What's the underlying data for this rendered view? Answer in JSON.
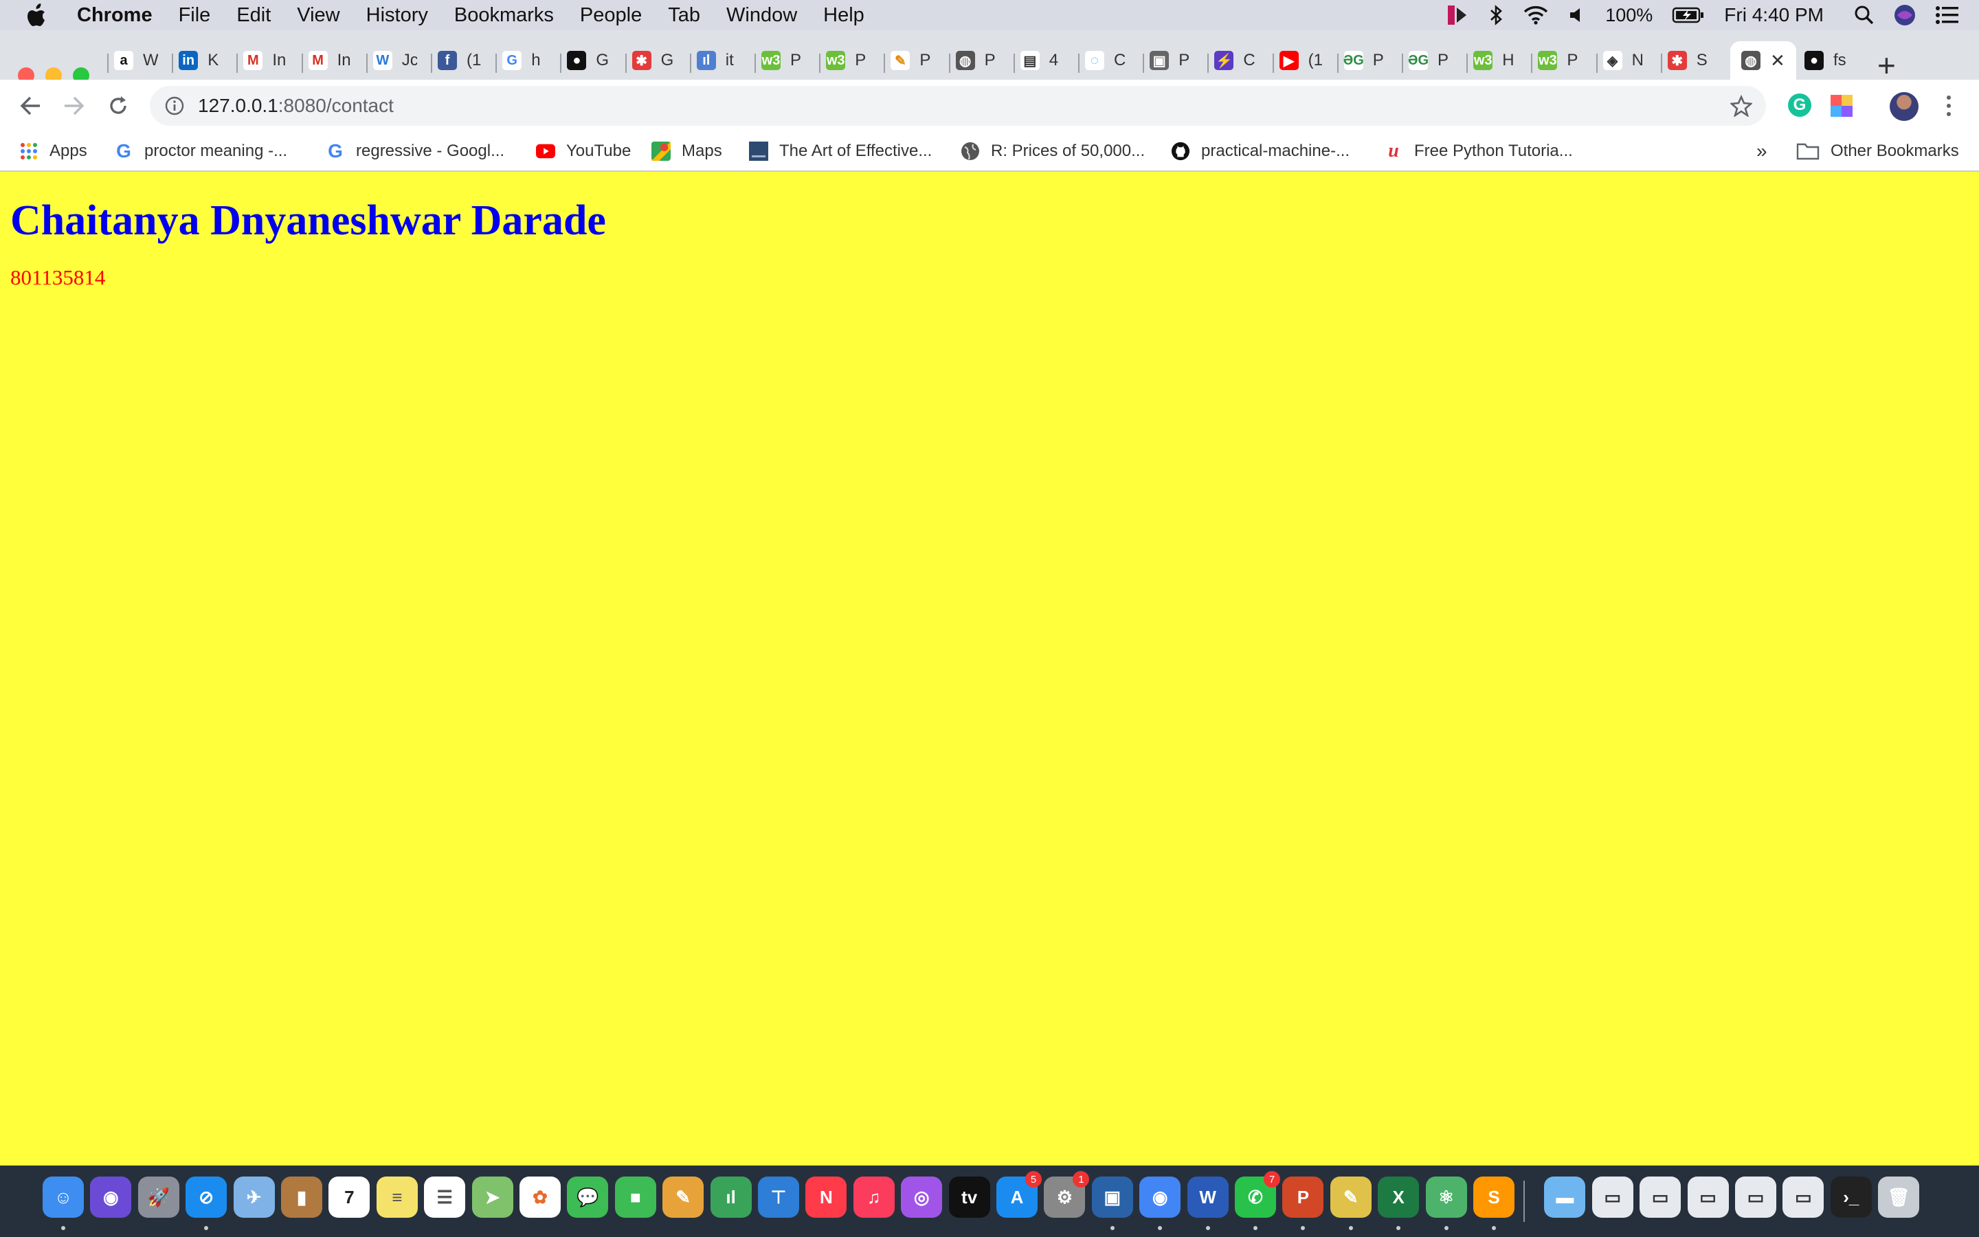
{
  "menubar": {
    "app_name": "Chrome",
    "items": [
      "File",
      "Edit",
      "View",
      "History",
      "Bookmarks",
      "People",
      "Tab",
      "Window",
      "Help"
    ],
    "battery": "100%",
    "clock": "Fri 4:40 PM"
  },
  "tabs": [
    {
      "label": "W",
      "icon": "amazon-icon",
      "color": "#ffffff",
      "glyph": "a",
      "fg": "#111"
    },
    {
      "label": "K",
      "icon": "linkedin-icon",
      "color": "#0a66c2",
      "glyph": "in",
      "fg": "#fff"
    },
    {
      "label": "In",
      "icon": "gmail-icon",
      "color": "#ffffff",
      "glyph": "M",
      "fg": "#d93025"
    },
    {
      "label": "In",
      "icon": "gmail-icon",
      "color": "#ffffff",
      "glyph": "M",
      "fg": "#d93025"
    },
    {
      "label": "Jc",
      "icon": "w-icon",
      "color": "#ffffff",
      "glyph": "W",
      "fg": "#2b7bd6"
    },
    {
      "label": "(1",
      "icon": "facebook-icon",
      "color": "#3b5998",
      "glyph": "f",
      "fg": "#fff"
    },
    {
      "label": "h",
      "icon": "google-icon",
      "color": "#ffffff",
      "glyph": "G",
      "fg": "#4285f4"
    },
    {
      "label": "G",
      "icon": "github-icon",
      "color": "#111111",
      "glyph": "●",
      "fg": "#fff"
    },
    {
      "label": "G",
      "icon": "gear-red-icon",
      "color": "#e33b3b",
      "glyph": "✱",
      "fg": "#fff"
    },
    {
      "label": "it",
      "icon": "chart-icon",
      "color": "#4f7fd1",
      "glyph": "ıl",
      "fg": "#fff"
    },
    {
      "label": "P",
      "icon": "w3schools-icon",
      "color": "#6cbf3a",
      "glyph": "w3",
      "fg": "#fff"
    },
    {
      "label": "P",
      "icon": "w3schools-icon",
      "color": "#6cbf3a",
      "glyph": "w3",
      "fg": "#fff"
    },
    {
      "label": "P",
      "icon": "pen-icon",
      "color": "#ffffff",
      "glyph": "✎",
      "fg": "#e58a00"
    },
    {
      "label": "P",
      "icon": "globe-icon",
      "color": "#555555",
      "glyph": "◍",
      "fg": "#fff"
    },
    {
      "label": "4",
      "icon": "doc-icon",
      "color": "#ffffff",
      "glyph": "▤",
      "fg": "#333"
    },
    {
      "label": "C",
      "icon": "circle-icon",
      "color": "#ffffff",
      "glyph": "◌",
      "fg": "#2aa6e0"
    },
    {
      "label": "P",
      "icon": "image-icon",
      "color": "#666666",
      "glyph": "▣",
      "fg": "#fff"
    },
    {
      "label": "C",
      "icon": "bolt-icon",
      "color": "#5b3bc4",
      "glyph": "⚡",
      "fg": "#fff"
    },
    {
      "label": "(1",
      "icon": "youtube-icon",
      "color": "#ff0000",
      "glyph": "▶",
      "fg": "#fff"
    },
    {
      "label": "P",
      "icon": "geeks-icon",
      "color": "#ffffff",
      "glyph": "ƏG",
      "fg": "#2f8d46"
    },
    {
      "label": "P",
      "icon": "geeks-icon",
      "color": "#ffffff",
      "glyph": "ƏG",
      "fg": "#2f8d46"
    },
    {
      "label": "H",
      "icon": "w3schools-icon",
      "color": "#6cbf3a",
      "glyph": "w3",
      "fg": "#fff"
    },
    {
      "label": "P",
      "icon": "w3schools-icon",
      "color": "#6cbf3a",
      "glyph": "w3",
      "fg": "#fff"
    },
    {
      "label": "N",
      "icon": "diamond-icon",
      "color": "#ffffff",
      "glyph": "◈",
      "fg": "#333"
    },
    {
      "label": "S",
      "icon": "gear-red-icon",
      "color": "#e33b3b",
      "glyph": "✱",
      "fg": "#fff"
    }
  ],
  "active_tab": {
    "icon": "globe-icon",
    "close": "✕"
  },
  "last_tab": {
    "label": "fs",
    "icon": "github-icon"
  },
  "new_tab": "+",
  "omnibox": {
    "host": "127.0.0.1",
    "rest": ":8080/contact"
  },
  "bookmarks": [
    {
      "label": "Apps",
      "icon": "apps-grid-icon"
    },
    {
      "label": "proctor meaning -...",
      "icon": "google-icon"
    },
    {
      "label": "regressive - Googl...",
      "icon": "google-icon"
    },
    {
      "label": "YouTube",
      "icon": "youtube-icon"
    },
    {
      "label": "Maps",
      "icon": "maps-icon"
    },
    {
      "label": "The Art of Effective...",
      "icon": "book-icon"
    },
    {
      "label": "R: Prices of 50,000...",
      "icon": "globe-icon"
    },
    {
      "label": "practical-machine-...",
      "icon": "github-icon"
    },
    {
      "label": "Free Python Tutoria...",
      "icon": "udemy-icon"
    }
  ],
  "bookmarks_overflow": "»",
  "other_bookmarks": "Other Bookmarks",
  "page": {
    "title": "Chaitanya Dnyaneshwar Darade",
    "phone": "801135814",
    "title_color": "#0000ee",
    "phone_color": "#ff0000",
    "background": "#ffff3c"
  },
  "dock": {
    "apps": [
      {
        "name": "finder-icon",
        "color": "#3d8ef0",
        "glyph": "☺"
      },
      {
        "name": "siri-icon",
        "color": "#6b4bd6",
        "glyph": "◉"
      },
      {
        "name": "launchpad-icon",
        "color": "#8a8f99",
        "glyph": "🚀"
      },
      {
        "name": "safari-icon",
        "color": "#1a8cf0",
        "glyph": "⊘"
      },
      {
        "name": "mail-icon",
        "color": "#7fb3e8",
        "glyph": "✈"
      },
      {
        "name": "contacts-icon",
        "color": "#b0793f",
        "glyph": "▮"
      },
      {
        "name": "calendar-icon",
        "color": "#ffffff",
        "glyph": "7",
        "fg": "#222"
      },
      {
        "name": "notes-icon",
        "color": "#f5e26a",
        "glyph": "≡",
        "fg": "#555"
      },
      {
        "name": "reminders-icon",
        "color": "#ffffff",
        "glyph": "☰",
        "fg": "#555"
      },
      {
        "name": "maps-icon",
        "color": "#7fc26b",
        "glyph": "➤"
      },
      {
        "name": "photos-icon",
        "color": "#ffffff",
        "glyph": "✿",
        "fg": "#e86b2b"
      },
      {
        "name": "messages-icon",
        "color": "#3dbb55",
        "glyph": "💬"
      },
      {
        "name": "facetime-icon",
        "color": "#3dbb55",
        "glyph": "■"
      },
      {
        "name": "keynote-icon",
        "color": "#e7a33a",
        "glyph": "✎"
      },
      {
        "name": "numbers-icon",
        "color": "#3aa35a",
        "glyph": "ıl"
      },
      {
        "name": "keynote-podium-icon",
        "color": "#2e7dd6",
        "glyph": "⊤"
      },
      {
        "name": "news-icon",
        "color": "#ff3b4a",
        "glyph": "N"
      },
      {
        "name": "music-icon",
        "color": "#fc3c5c",
        "glyph": "♫"
      },
      {
        "name": "podcasts-icon",
        "color": "#a155e8",
        "glyph": "◎"
      },
      {
        "name": "tv-icon",
        "color": "#111111",
        "glyph": "tv"
      },
      {
        "name": "appstore-icon",
        "color": "#1a8cf0",
        "glyph": "A",
        "badge": "5"
      },
      {
        "name": "system-preferences-icon",
        "color": "#888888",
        "glyph": "⚙",
        "badge": "1"
      },
      {
        "name": "virtualbox-icon",
        "color": "#2a62a8",
        "glyph": "▣"
      },
      {
        "name": "chrome-icon",
        "color": "#4285f4",
        "glyph": "◉"
      },
      {
        "name": "word-icon",
        "color": "#2b5bb8",
        "glyph": "W"
      },
      {
        "name": "whatsapp-icon",
        "color": "#28c24a",
        "glyph": "✆",
        "badge": "7"
      },
      {
        "name": "powerpoint-icon",
        "color": "#d24726",
        "glyph": "P"
      },
      {
        "name": "python-icon",
        "color": "#e0c24a",
        "glyph": "✎"
      },
      {
        "name": "excel-icon",
        "color": "#1d7a43",
        "glyph": "X"
      },
      {
        "name": "atom-icon",
        "color": "#4db36b",
        "glyph": "⚛"
      },
      {
        "name": "sublime-icon",
        "color": "#ff9800",
        "glyph": "S"
      },
      {
        "name": "folder-icon",
        "color": "#6fb6f0",
        "glyph": "▬"
      },
      {
        "name": "window-thumb-icon",
        "color": "#e6e9ee",
        "glyph": "▭",
        "fg": "#333"
      },
      {
        "name": "window-thumb-icon",
        "color": "#e6e9ee",
        "glyph": "▭",
        "fg": "#333"
      },
      {
        "name": "window-thumb-icon",
        "color": "#e6e9ee",
        "glyph": "▭",
        "fg": "#333"
      },
      {
        "name": "window-thumb-icon",
        "color": "#e6e9ee",
        "glyph": "▭",
        "fg": "#333"
      },
      {
        "name": "window-thumb-icon",
        "color": "#e6e9ee",
        "glyph": "▭",
        "fg": "#333"
      },
      {
        "name": "terminal-icon",
        "color": "#222222",
        "glyph": "›_"
      },
      {
        "name": "trash-icon",
        "color": "#c7ccd3",
        "glyph": "🗑"
      }
    ]
  }
}
